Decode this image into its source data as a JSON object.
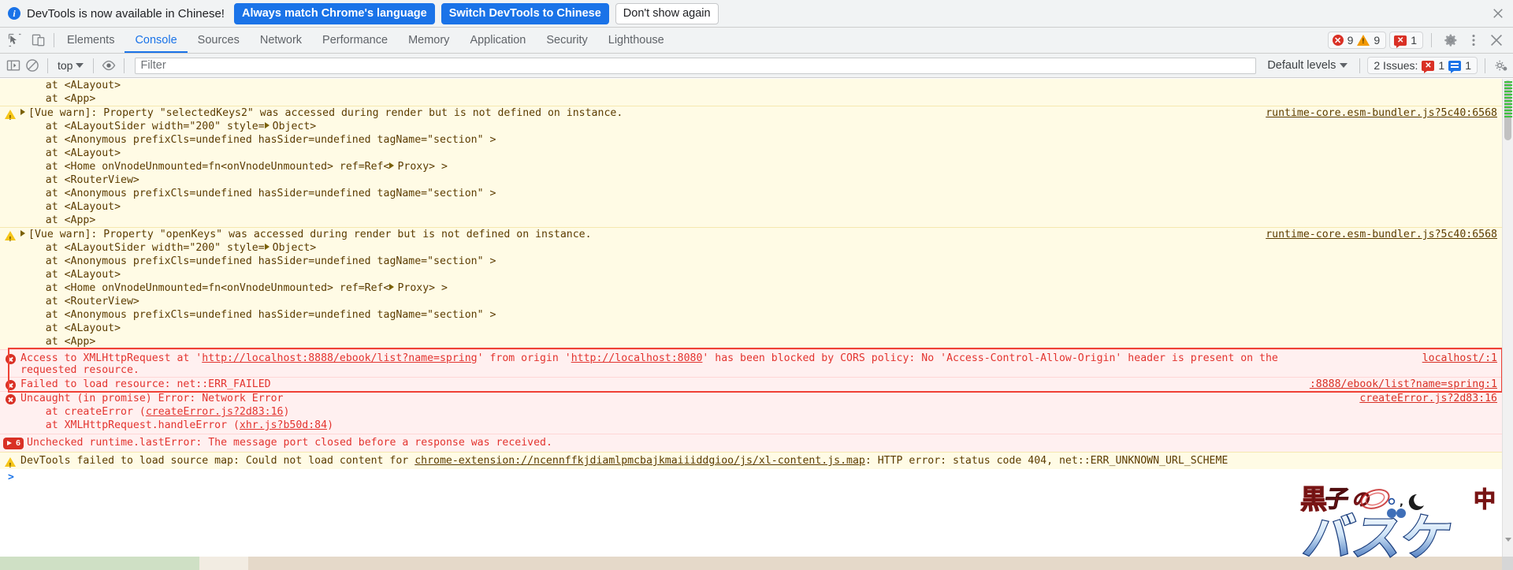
{
  "banner": {
    "icon": "info-icon",
    "message": "DevTools is now available in Chinese!",
    "btn_always": "Always match Chrome's language",
    "btn_switch": "Switch DevTools to Chinese",
    "btn_dismiss": "Don't show again",
    "close_icon": "close-icon",
    "accent_color": "#1a73e8"
  },
  "tabbar": {
    "inspect_icon": "inspect-element-icon",
    "device_icon": "device-toolbar-icon",
    "tabs": [
      {
        "label": "Elements",
        "active": false
      },
      {
        "label": "Console",
        "active": true
      },
      {
        "label": "Sources",
        "active": false
      },
      {
        "label": "Network",
        "active": false
      },
      {
        "label": "Performance",
        "active": false
      },
      {
        "label": "Memory",
        "active": false
      },
      {
        "label": "Application",
        "active": false
      },
      {
        "label": "Security",
        "active": false
      },
      {
        "label": "Lighthouse",
        "active": false
      }
    ],
    "error_count": "9",
    "warning_count": "9",
    "message_count": "1",
    "settings_icon": "gear-icon",
    "more_icon": "kebab-menu-icon",
    "close_icon": "close-devtools-icon",
    "error_color": "#d93025",
    "warning_color": "#f29900",
    "active_tab_color": "#1a73e8"
  },
  "filterbar": {
    "sidebar_icon": "console-sidebar-icon",
    "clear_icon": "clear-console-icon",
    "context": "top",
    "eye_icon": "live-expression-eye-icon",
    "filter_placeholder": "Filter",
    "filter_value": "",
    "levels_label": "Default levels",
    "issues_label": "2 Issues:",
    "issues_error_count": "1",
    "issues_info_count": "1",
    "capture_icon": "capture-screenshot-icon",
    "settings_icon": "console-settings-gear-icon"
  },
  "console": {
    "entries": [
      {
        "kind": "stack-warn",
        "text": "    at <ALayout>"
      },
      {
        "kind": "stack-warn",
        "text": "    at <App>"
      },
      {
        "kind": "warn",
        "text": "[Vue warn]: Property \"selectedKeys2\" was accessed during render but is not defined on instance.",
        "link": "runtime-core.esm-bundler.js?5c40:6568",
        "disclosure": true
      },
      {
        "kind": "stack-warn-obj",
        "pre": "    at <ALayoutSider width=\"200\" style=",
        "obj": "Object",
        "post": ">"
      },
      {
        "kind": "stack-warn",
        "text": "    at <Anonymous prefixCls=undefined hasSider=undefined tagName=\"section\" >"
      },
      {
        "kind": "stack-warn",
        "text": "    at <ALayout>"
      },
      {
        "kind": "stack-warn-obj2",
        "pre": "    at <Home onVnodeUnmounted=fn<onVnodeUnmounted> ref=Ref<",
        "obj": "Proxy",
        "post": "> >"
      },
      {
        "kind": "stack-warn",
        "text": "    at <RouterView>"
      },
      {
        "kind": "stack-warn",
        "text": "    at <Anonymous prefixCls=undefined hasSider=undefined tagName=\"section\" >"
      },
      {
        "kind": "stack-warn",
        "text": "    at <ALayout>"
      },
      {
        "kind": "stack-warn",
        "text": "    at <App>"
      },
      {
        "kind": "warn",
        "text": "[Vue warn]: Property \"openKeys\" was accessed during render but is not defined on instance.",
        "link": "runtime-core.esm-bundler.js?5c40:6568",
        "disclosure": true
      },
      {
        "kind": "stack-warn-obj",
        "pre": "    at <ALayoutSider width=\"200\" style=",
        "obj": "Object",
        "post": ">"
      },
      {
        "kind": "stack-warn",
        "text": "    at <Anonymous prefixCls=undefined hasSider=undefined tagName=\"section\" >"
      },
      {
        "kind": "stack-warn",
        "text": "    at <ALayout>"
      },
      {
        "kind": "stack-warn-obj2",
        "pre": "    at <Home onVnodeUnmounted=fn<onVnodeUnmounted> ref=Ref<",
        "obj": "Proxy",
        "post": "> >"
      },
      {
        "kind": "stack-warn",
        "text": "    at <RouterView>"
      },
      {
        "kind": "stack-warn",
        "text": "    at <Anonymous prefixCls=undefined hasSider=undefined tagName=\"section\" >"
      },
      {
        "kind": "stack-warn",
        "text": "    at <ALayout>"
      },
      {
        "kind": "stack-warn",
        "text": "    at <App>"
      }
    ],
    "cors_error": {
      "part1": "Access to XMLHttpRequest at '",
      "url1": "http://localhost:8888/ebook/list?name=spring",
      "part2": "' from origin '",
      "url2": "http://localhost:8080",
      "part3": "' has been blocked by CORS policy: No 'Access-Control-Allow-Origin' header is present on the",
      "part4": "requested resource.",
      "link": "localhost/:1"
    },
    "failed_resource": {
      "text": "Failed to load resource: net::ERR_FAILED",
      "link": ":8888/ebook/list?name=spring:1"
    },
    "uncaught": {
      "text": "Uncaught (in promise) Error: Network Error",
      "link": "createError.js?2d83:16",
      "stack": [
        {
          "pre": "    at createError (",
          "link": "createError.js?2d83:16",
          "post": ")"
        },
        {
          "pre": "    at XMLHttpRequest.handleError (",
          "link": "xhr.js?b50d:84",
          "post": ")"
        }
      ]
    },
    "runtime_error": {
      "badge_count": "6",
      "text": "Unchecked runtime.lastError: The message port closed before a response was received."
    },
    "sourcemap_warn": {
      "part1": "DevTools failed to load source map: Could not load content for ",
      "url": "chrome-extension://ncennffkjdiamlpmcbajkmaiiiddgioo/js/xl-content.js.map",
      "part2": ": HTTP error: status code 404, net::ERR_UNKNOWN_URL_SCHEME"
    },
    "prompt": ">"
  },
  "watermark": {
    "name": "kuro-tele-bassui-logo",
    "top_text": "黒子の",
    "bottom_text": "バスケ",
    "corner_text": "中",
    "moon_icon": "moon-icon"
  }
}
